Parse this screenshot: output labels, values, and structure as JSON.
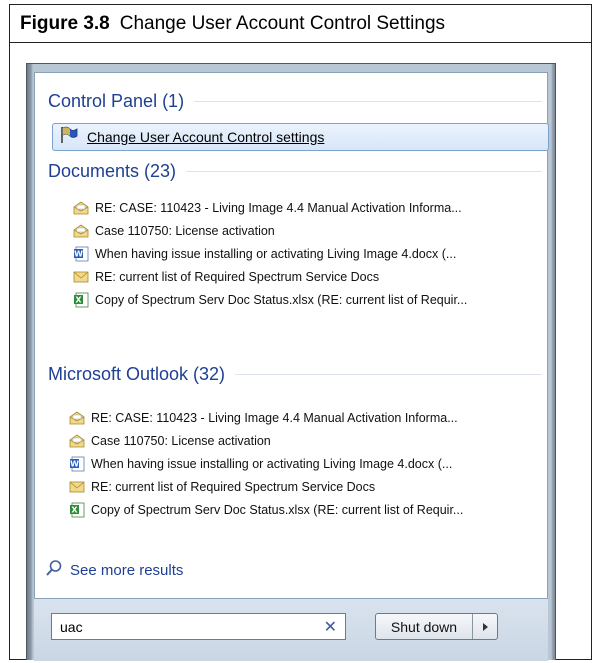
{
  "figure": {
    "number": "Figure 3.8",
    "title": "Change User Account Control Settings"
  },
  "control_panel": {
    "header": "Control Panel (1)",
    "item": {
      "label": "Change User Account Control settings",
      "icon": "uac-flag-icon"
    }
  },
  "documents": {
    "header": "Documents (23)",
    "items": [
      {
        "label": "RE: CASE: 110423 - Living Image 4.4 Manual Activation Informa...",
        "icon": "open-envelope-icon"
      },
      {
        "label": "Case 110750: License activation",
        "icon": "open-envelope-icon"
      },
      {
        "label": "When having issue installing or activating Living Image 4.docx (...",
        "icon": "word-doc-icon"
      },
      {
        "label": "RE: current list of Required Spectrum Service Docs",
        "icon": "envelope-icon"
      },
      {
        "label": "Copy of Spectrum Serv Doc Status.xlsx (RE: current list of Requir...",
        "icon": "excel-doc-icon"
      }
    ]
  },
  "outlook": {
    "header": "Microsoft Outlook (32)",
    "items": [
      {
        "label": "RE: CASE: 110423 - Living Image 4.4 Manual Activation Informa...",
        "icon": "open-envelope-icon"
      },
      {
        "label": "Case 110750: License activation",
        "icon": "open-envelope-icon"
      },
      {
        "label": "When having issue installing or activating Living Image 4.docx (...",
        "icon": "word-doc-icon"
      },
      {
        "label": "RE: current list of Required Spectrum Service Docs",
        "icon": "envelope-icon"
      },
      {
        "label": "Copy of Spectrum Serv Doc Status.xlsx (RE: current list of Requir...",
        "icon": "excel-doc-icon"
      }
    ]
  },
  "see_more": {
    "label": "See more results",
    "icon": "search-icon"
  },
  "search": {
    "value": "uac",
    "clear_icon": "close-icon"
  },
  "shutdown": {
    "label": "Shut down",
    "icon": "chevron-right-icon"
  },
  "colors": {
    "header_blue": "#1e3f93",
    "highlight_border": "#7da2ce",
    "highlight_fill": "#dde9f8"
  }
}
